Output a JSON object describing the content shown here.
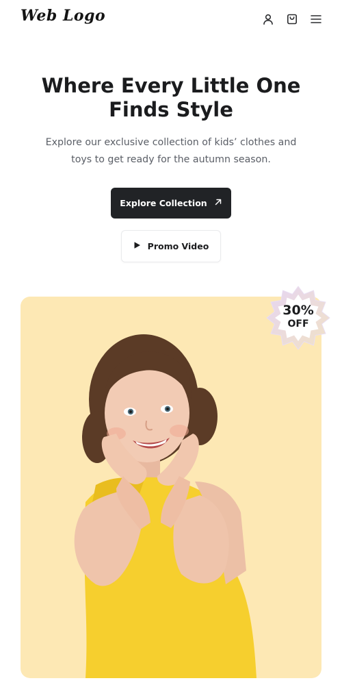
{
  "header": {
    "logo": "Web Logo",
    "icons": [
      "user-icon",
      "shopping-bag-icon",
      "menu-icon"
    ]
  },
  "hero": {
    "title": "Where Every Little One Finds Style",
    "description": "Explore our exclusive collection of kids’ clothes and toys to get ready for the autumn season.",
    "primary_button": {
      "label": "Explore Collection",
      "icon": "arrow-up-right-icon"
    },
    "secondary_button": {
      "label": "Promo Video",
      "icon": "play-icon"
    }
  },
  "badge": {
    "percent": "30%",
    "label": "OFF"
  },
  "colors": {
    "primary_button_bg": "#212326",
    "card_bg": "#fde8b4",
    "dress": "#f6cf2e",
    "badge_border": "#e3d6ef",
    "text_dark": "#1b1c1e",
    "text_muted": "#5a5e66"
  }
}
